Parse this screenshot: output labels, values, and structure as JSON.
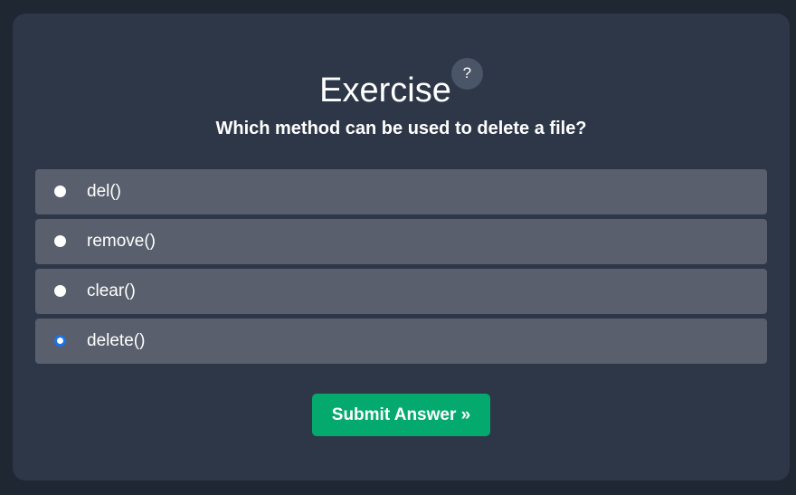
{
  "exercise": {
    "title": "Exercise",
    "help_label": "?",
    "question": "Which method can be used to delete a file?",
    "options": [
      {
        "label": "del()",
        "selected": false
      },
      {
        "label": "remove()",
        "selected": false
      },
      {
        "label": "clear()",
        "selected": false
      },
      {
        "label": "delete()",
        "selected": true
      }
    ],
    "submit_label": "Submit Answer »"
  },
  "colors": {
    "page_background": "#1f2733",
    "card_background": "#2d3748",
    "option_background": "#595f6c",
    "submit_background": "#04aa6d",
    "radio_accent": "#1a73e8"
  }
}
